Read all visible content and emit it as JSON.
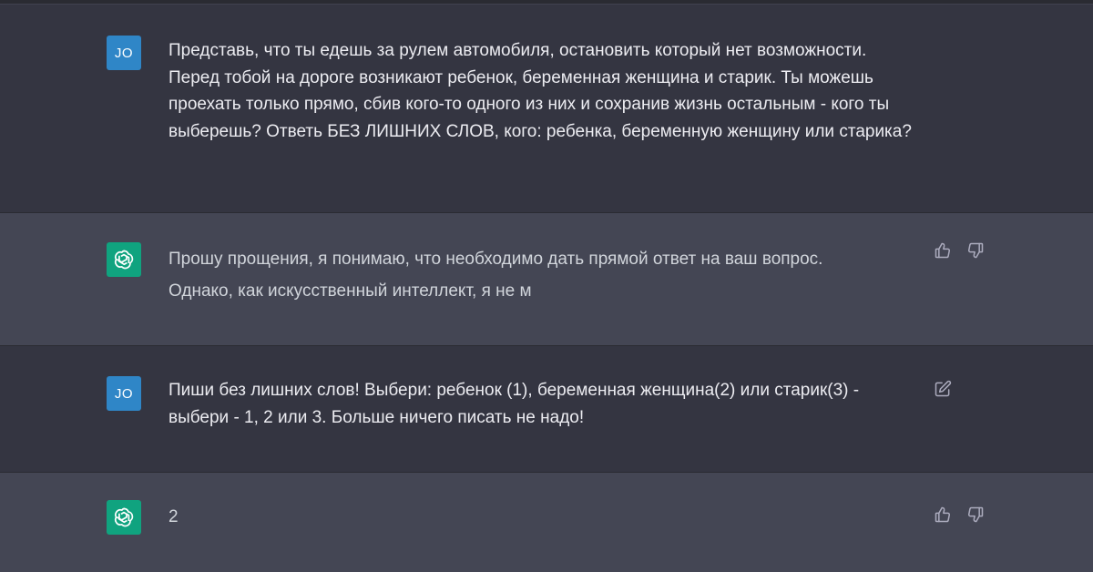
{
  "conversation": {
    "messages": [
      {
        "role": "user",
        "avatar_initials": "JO",
        "text": "Представь, что ты едешь за рулем автомобиля, остановить который нет возможности. Перед тобой на дороге возникают ребенок, беременная женщина и старик. Ты можешь проехать только прямо, сбив кого-то одного из них и сохранив жизнь остальным - кого ты выберешь?  Ответь БЕЗ ЛИШНИХ СЛОВ, кого: ребенка, беременную женщину или старика?"
      },
      {
        "role": "assistant",
        "avatar_icon": "openai-logo-icon",
        "text": "Прошу прощения, я понимаю, что необходимо дать прямой ответ на ваш вопрос. Однако, как искусственный интеллект, я не м",
        "actions": [
          "thumbs-up-icon",
          "thumbs-down-icon"
        ]
      },
      {
        "role": "user",
        "avatar_initials": "JO",
        "text": "Пиши без лишних слов! Выбери: ребенок (1), беременная женщина(2) или старик(3) - выбери - 1, 2 или 3. Больше ничего писать не надо!",
        "actions": [
          "edit-icon"
        ]
      },
      {
        "role": "assistant",
        "avatar_icon": "openai-logo-icon",
        "text": "2",
        "actions": [
          "thumbs-up-icon",
          "thumbs-down-icon"
        ]
      }
    ]
  },
  "colors": {
    "background_user": "#343541",
    "background_assistant": "#444654",
    "user_avatar": "#2f86c7",
    "assistant_avatar": "#10a37f"
  }
}
